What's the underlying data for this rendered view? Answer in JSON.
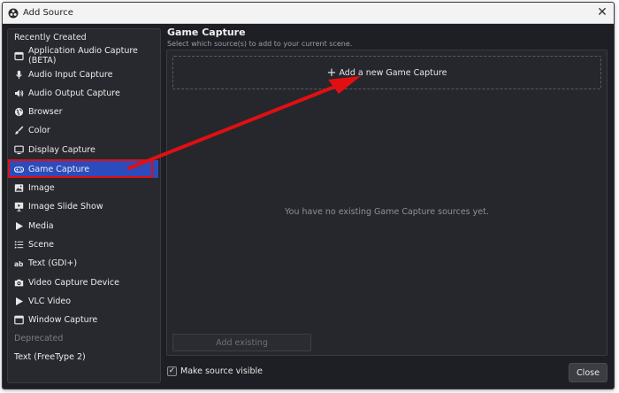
{
  "window": {
    "title": "Add Source",
    "app_icon": "obs-logo-icon",
    "close_glyph": "✕"
  },
  "sidebar": {
    "section_recent": "Recently Created",
    "items": [
      {
        "label": "Application Audio Capture (BETA)",
        "icon": "app-window-icon"
      },
      {
        "label": "Audio Input Capture",
        "icon": "microphone-icon"
      },
      {
        "label": "Audio Output Capture",
        "icon": "speaker-icon"
      },
      {
        "label": "Browser",
        "icon": "globe-icon"
      },
      {
        "label": "Color",
        "icon": "paintbrush-icon"
      },
      {
        "label": "Display Capture",
        "icon": "monitor-icon"
      },
      {
        "label": "Game Capture",
        "icon": "gamepad-icon",
        "selected": true
      },
      {
        "label": "Image",
        "icon": "image-icon"
      },
      {
        "label": "Image Slide Show",
        "icon": "slideshow-icon"
      },
      {
        "label": "Media",
        "icon": "play-icon"
      },
      {
        "label": "Scene",
        "icon": "list-icon"
      },
      {
        "label": "Text (GDI+)",
        "icon": "text-icon"
      },
      {
        "label": "Video Capture Device",
        "icon": "camera-icon"
      },
      {
        "label": "VLC Video",
        "icon": "play-icon"
      },
      {
        "label": "Window Capture",
        "icon": "window-icon"
      }
    ],
    "section_deprecated": "Deprecated",
    "deprecated_items": [
      {
        "label": "Text (FreeType 2)"
      }
    ]
  },
  "main": {
    "title": "Game Capture",
    "subtitle": "Select which source(s) to add to your current scene.",
    "add_new_label": "Add a new Game Capture",
    "empty_text": "You have no existing Game Capture sources yet.",
    "add_existing_label": "Add existing"
  },
  "footer": {
    "make_visible_label": "Make source visible",
    "make_visible_checked": true,
    "close_label": "Close"
  },
  "colors": {
    "selected": "#2c4bbd",
    "annotation": "#e10f12",
    "background": "#1e1f24"
  }
}
